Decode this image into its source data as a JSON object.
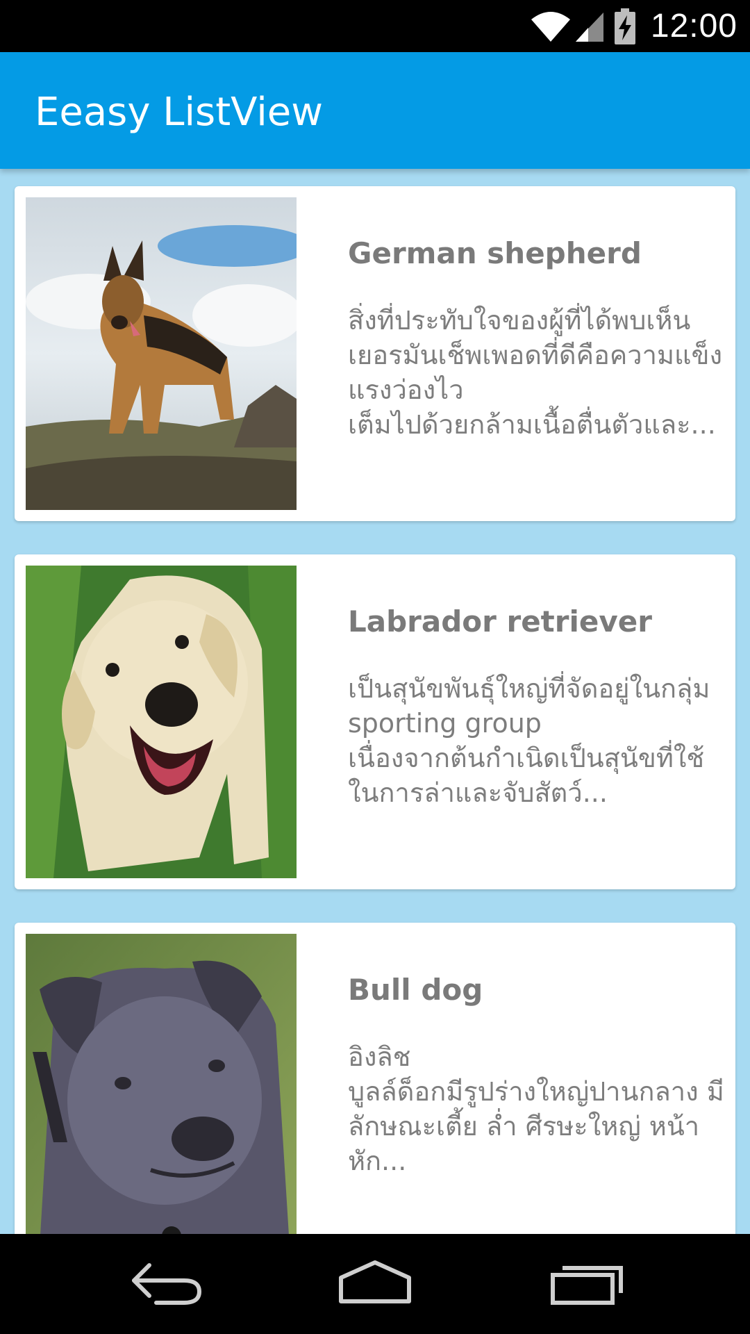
{
  "status_bar": {
    "time": "12:00",
    "icons": [
      "wifi-icon",
      "cell-signal-icon",
      "battery-charging-icon"
    ]
  },
  "app_bar": {
    "title": "Eeasy ListView",
    "color": "#049be5"
  },
  "list": {
    "background": "#a7daf2",
    "items": [
      {
        "title": "German shepherd",
        "description": "สิ่งที่ประทับใจของผู้ที่ได้พบเห็นเยอรมันเช็พเพอดที่ดีคือความแข็งแรงว่องไว\nเต็มไปด้วยกล้ามเนื้อตื่นตัวและ...",
        "image": "german-shepherd-photo"
      },
      {
        "title": "Labrador retriever",
        "description": "เป็นสุนัขพันธุ์ใหญ่ที่จัดอยู่ในกลุ่ม sporting group\nเนื่องจากต้นกำเนิดเป็นสุนัขที่ใช้ในการล่าและจับสัตว์...",
        "image": "labrador-retriever-photo"
      },
      {
        "title": "Bull dog",
        "description": "อิงลิช\nบูลล์ด็อกมีรูปร่างใหญ่ปานกลาง มีลักษณะเตี้ย ล่ำ ศีรษะใหญ่ หน้าหัก...",
        "image": "bull-dog-photo"
      }
    ]
  },
  "nav_bar": {
    "buttons": [
      "back-icon",
      "home-icon",
      "recent-apps-icon"
    ]
  }
}
